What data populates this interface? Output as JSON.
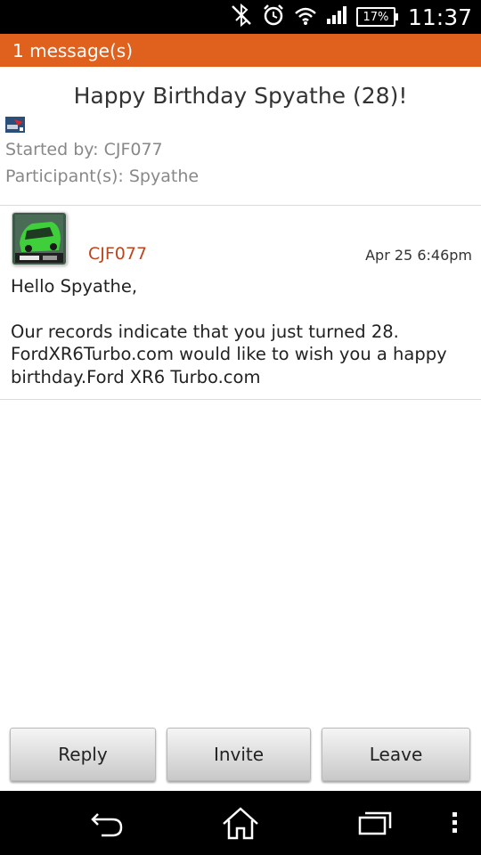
{
  "status_bar": {
    "battery": "17%",
    "time": "11:37",
    "icons": [
      "bluetooth-off-icon",
      "alarm-icon",
      "wifi-icon",
      "signal-icon",
      "battery-icon"
    ]
  },
  "banner": {
    "label": "1 message(s)"
  },
  "thread": {
    "title": "Happy Birthday Spyathe (28)!",
    "started_by": "Started by: CJF077",
    "participants": "Participant(s): Spyathe"
  },
  "message": {
    "author": "CJF077",
    "date": "Apr 25 6:46pm",
    "greeting": "Hello Spyathe,",
    "body": "Our records indicate that you just turned 28. FordXR6Turbo.com would like to wish you a happy birthday.Ford XR6 Turbo.com"
  },
  "actions": {
    "reply": "Reply",
    "invite": "Invite",
    "leave": "Leave"
  },
  "nav": {
    "icons": [
      "back-icon",
      "home-icon",
      "recent-apps-icon",
      "menu-icon"
    ]
  },
  "colors": {
    "accent": "#e0601e",
    "author": "#c0451c"
  }
}
